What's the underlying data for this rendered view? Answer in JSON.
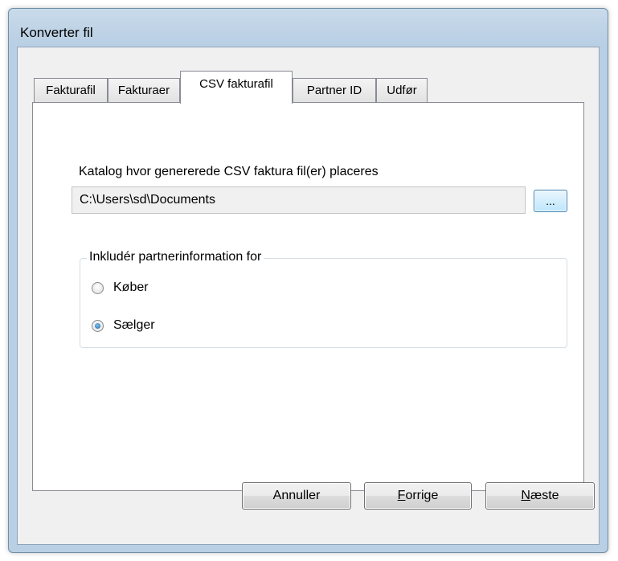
{
  "window": {
    "title": "Konverter fil"
  },
  "tabs": [
    {
      "label": "Fakturafil",
      "active": false
    },
    {
      "label": "Fakturaer",
      "active": false
    },
    {
      "label": "CSV fakturafil",
      "active": true
    },
    {
      "label": "Partner ID",
      "active": false
    },
    {
      "label": "Udfør",
      "active": false
    }
  ],
  "csv_panel": {
    "catalog_label": "Katalog hvor genererede CSV faktura fil(er) placeres",
    "catalog_path": "C:\\Users\\sd\\Documents",
    "browse_label": "...",
    "group_title": "Inkludér partnerinformation for",
    "options": [
      {
        "label": "Køber",
        "checked": false
      },
      {
        "label": "Sælger",
        "checked": true
      }
    ]
  },
  "buttons": {
    "cancel": {
      "label": "Annuller"
    },
    "back": {
      "mnemonic": "F",
      "rest": "orrige"
    },
    "next": {
      "mnemonic": "N",
      "rest": "æste"
    }
  }
}
